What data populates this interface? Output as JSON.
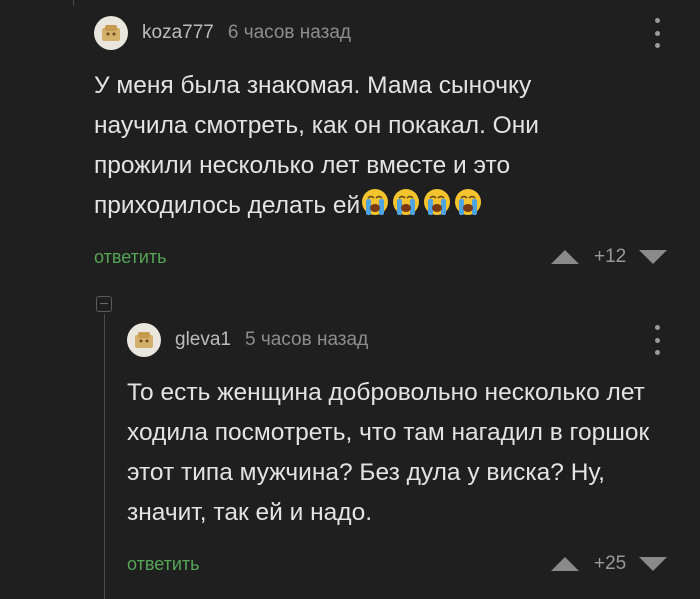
{
  "comments": [
    {
      "username": "koza777",
      "time": "6 часов назад",
      "text": "У меня была знакомая. Мама сыночку научила смотреть, как он покакал. Они прожили несколько лет вместе и это приходилось делать ей",
      "emoji": [
        "loudly-crying-face",
        "loudly-crying-face",
        "loudly-crying-face",
        "loudly-crying-face"
      ],
      "reply_label": "ответить",
      "score": "+12"
    },
    {
      "username": "gleva1",
      "time": "5 часов назад",
      "text": "То есть женщина добровольно несколько лет ходила посмотреть, что там нагадил в горшок этот типа мужчина? Без дула у виска? Ну, значит, так ей и надо.",
      "reply_label": "ответить",
      "score": "+25"
    }
  ],
  "colors": {
    "background": "#1f1f1f",
    "text": "#e3e3e3",
    "reply": "#54a556",
    "muted": "#8d8d8d"
  }
}
